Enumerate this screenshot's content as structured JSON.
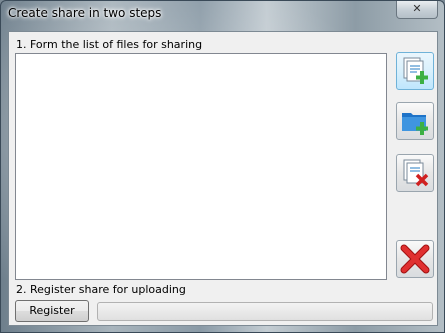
{
  "window": {
    "title": "Create share in two steps",
    "close_symbol": "✕"
  },
  "step1": {
    "label": "1. Form the list of files for sharing",
    "files": []
  },
  "toolbar": {
    "add_files_icon": "add-files-icon",
    "add_folder_icon": "add-folder-icon",
    "remove_file_icon": "remove-file-icon",
    "clear_list_icon": "clear-list-icon"
  },
  "step2": {
    "label": "2. Register share for uploading",
    "register_label": "Register",
    "progress": 0
  },
  "colors": {
    "accent_green": "#3cb043",
    "delete_red": "#d02020",
    "folder_blue": "#1e73c8"
  }
}
